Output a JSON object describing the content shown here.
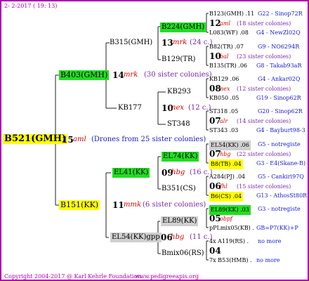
{
  "header": {
    "date": "2- 2-2017 ( 19: 13)"
  },
  "footer": {
    "copyright": "Copyright 2004-2017 @ Karl Kehrle Foundation.",
    "url": "www.pedigreeapis.org"
  },
  "root": {
    "name": "B521(GMH)",
    "num": "15",
    "mark": "aml",
    "note": "(Drones from 25 sister colonies)"
  },
  "g1": [
    {
      "name": "B403(GMH)",
      "num": "14",
      "mark": "mrk",
      "note": "(30 sister colonies)"
    },
    {
      "name": "B151(KK)",
      "num": "11",
      "mark": "mmk",
      "note": "(6 sister colonies)"
    }
  ],
  "g2": [
    {
      "name": "B315(GMH)",
      "num": "13",
      "mark": "mrk",
      "note": "(24 c.)"
    },
    {
      "name": "KB177",
      "num": "10",
      "mark": "nex",
      "note": "(12 c.)"
    },
    {
      "name": "EL41(KK)",
      "num": "09",
      "mark": "hbg",
      "note": "(16 c.)"
    },
    {
      "name": "EL54(KK)gpp",
      "num": "06",
      "mark": "hbg",
      "note": "(11 c.)"
    }
  ],
  "g3": [
    {
      "name": "B224(GMH)"
    },
    {
      "name": "B129(TR)"
    },
    {
      "name": "KB293"
    },
    {
      "name": "ST348"
    },
    {
      "name": "EL74(KK)"
    },
    {
      "name": "B351(CS)"
    },
    {
      "name": "EL89(KK)"
    },
    {
      "name": "Bmix06(RS)"
    }
  ],
  "g4": [
    {
      "top": "B123(GMH) .11",
      "topr": "G22 - Sinop72R",
      "num": "12",
      "mark": "aml",
      "note": "(18 sister colonies)",
      "bot": "L083(WF) .08",
      "botr": "G4 - NewZl02Q"
    },
    {
      "top": "B82(TR) .07",
      "topr": "G9 - NO6294R",
      "num": "10",
      "mark": "bal",
      "note": "(23 sister colonies)",
      "bot": "B135(TR) .06",
      "botr": "G8 - Takab93aR"
    },
    {
      "top": "KB129 .06",
      "topr": "G4 - Ankar02Q",
      "num": "08",
      "mark": "nex",
      "note": "(12 sister colonies)",
      "bot": "KB050 .05",
      "botr": "G19 - Sinop62R"
    },
    {
      "top": "ST318 .05",
      "topr": "G20 - Sinop62R",
      "num": "07",
      "mark": "alr",
      "note": "(14 sister colonies)",
      "bot": "ST343 .03",
      "botr": "G4 - Bayburt98-3"
    },
    {
      "top": "EL54(KK) .06",
      "topr": "G5 - notregiste",
      "num": "07",
      "mark": "hbg",
      "note": "(22 sister colonies)",
      "bot": "B8(TB) .04",
      "botr": "G3 - E4(Skane-B)"
    },
    {
      "top": "A284(PJ) .04",
      "topr": "G5 - Cankiri97Q",
      "num": "06",
      "mark": "fhl",
      "note": "(15 sister colonies)",
      "bot": "B6(CS) .04",
      "botr": "G13 - AthosSt80R"
    },
    {
      "top": "EL89(KK) .03",
      "topr": "G3 - notregiste",
      "num": "05",
      "mark": "obpf",
      "note": "",
      "bot": "pPLmix05(KB) .",
      "botr": "GB=P7(KK)+P"
    },
    {
      "top": "4x A119(RS) .",
      "topr": "no more",
      "num": "04",
      "mark": "",
      "note": "",
      "bot": "7x B53(HMB) .",
      "botr": "no more"
    }
  ]
}
